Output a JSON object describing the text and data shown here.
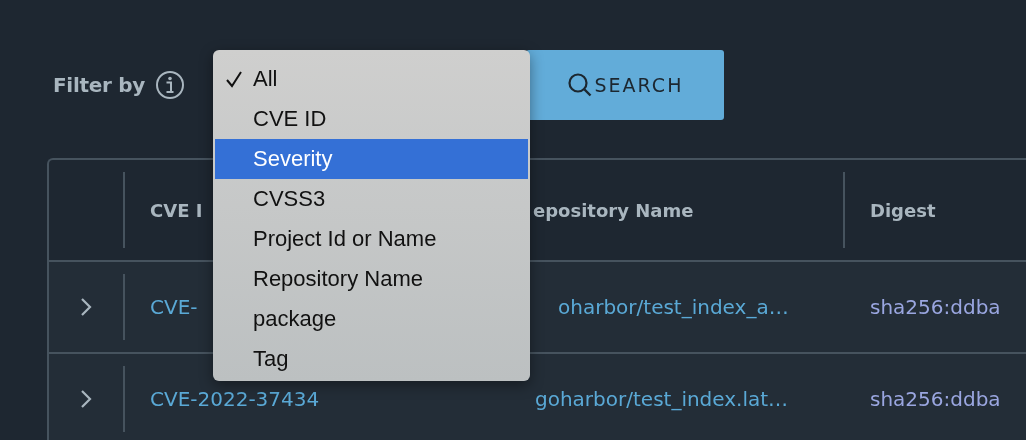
{
  "filter": {
    "label": "Filter by",
    "menu": [
      {
        "label": "All",
        "checked": true,
        "selected": false
      },
      {
        "label": "CVE ID",
        "checked": false,
        "selected": false
      },
      {
        "label": "Severity",
        "checked": false,
        "selected": true
      },
      {
        "label": "CVSS3",
        "checked": false,
        "selected": false
      },
      {
        "label": "Project Id or Name",
        "checked": false,
        "selected": false
      },
      {
        "label": "Repository Name",
        "checked": false,
        "selected": false
      },
      {
        "label": "package",
        "checked": false,
        "selected": false
      },
      {
        "label": "Tag",
        "checked": false,
        "selected": false
      }
    ]
  },
  "search_button": {
    "label": "SEARCH"
  },
  "table": {
    "columns": [
      {
        "label": "CVE I"
      },
      {
        "label": "epository Name",
        "cut_left": true
      },
      {
        "label": "Digest"
      }
    ],
    "rows": [
      {
        "cells": [
          {
            "text": "CVE-"
          },
          {
            "text": "oharbor/test_index_a…",
            "cut_left": true
          },
          {
            "text": "sha256:ddba"
          }
        ]
      },
      {
        "cells": [
          {
            "text": "CVE-2022-37434"
          },
          {
            "text": "goharbor/test_index.lat…"
          },
          {
            "text": "sha256:ddba"
          }
        ]
      }
    ]
  }
}
